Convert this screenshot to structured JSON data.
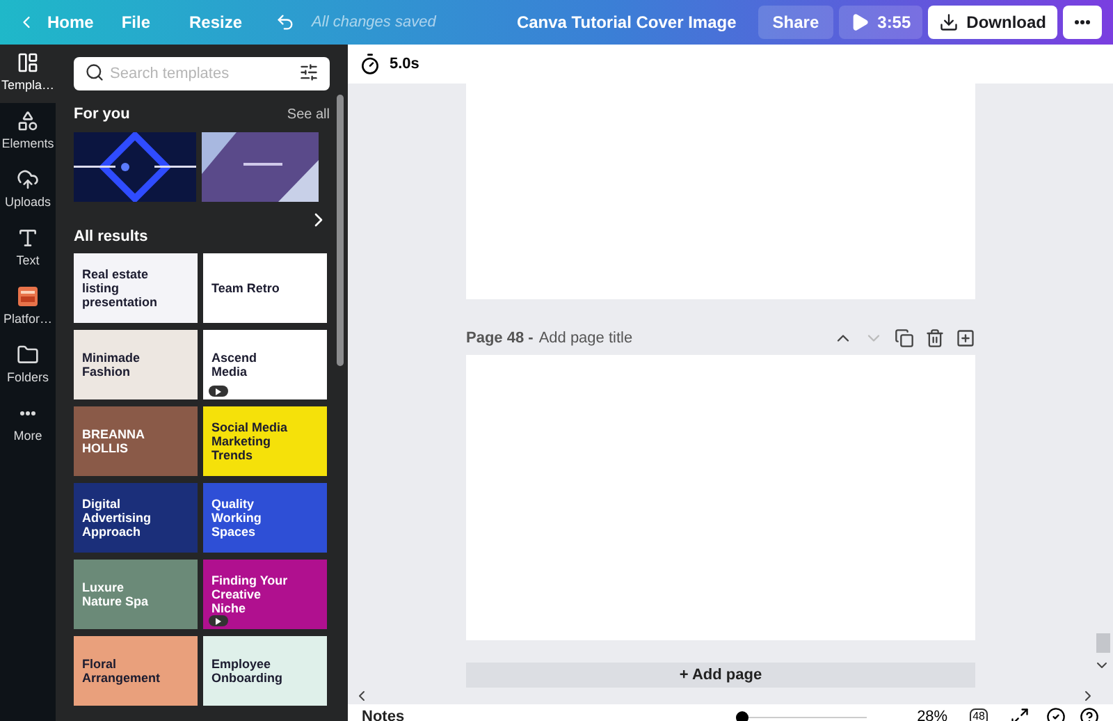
{
  "topbar": {
    "back": "Home",
    "menu": [
      "File",
      "Resize"
    ],
    "status": "All changes saved",
    "title": "Canva Tutorial Cover Image",
    "share": "Share",
    "duration": "3:55",
    "download": "Download"
  },
  "rail": [
    {
      "label": "Templa…",
      "kind": "templates",
      "selected": true
    },
    {
      "label": "Elements",
      "kind": "elements",
      "selected": false
    },
    {
      "label": "Uploads",
      "kind": "uploads",
      "selected": false
    },
    {
      "label": "Text",
      "kind": "text",
      "selected": false
    },
    {
      "label": "Platfor…",
      "kind": "platform",
      "selected": false
    },
    {
      "label": "Folders",
      "kind": "folders",
      "selected": false
    },
    {
      "label": "More",
      "kind": "more",
      "selected": false
    }
  ],
  "panel": {
    "search": {
      "placeholder": "Search templates"
    },
    "for_you": {
      "title": "For you",
      "see_all": "See all"
    },
    "results_title": "All results",
    "templates": [
      {
        "title": "Real estate listing presentation",
        "color": "#f4f4f8",
        "video": false
      },
      {
        "title": "Team Retro",
        "color": "#ffffff",
        "video": false
      },
      {
        "title": "Minimade Fashion",
        "color": "#ede7e1",
        "video": false
      },
      {
        "title": "Ascend Media",
        "color": "#ffffff",
        "video": true
      },
      {
        "title": "BREANNA HOLLIS",
        "color": "#8a5a48",
        "video": false
      },
      {
        "title": "Social Media Marketing Trends",
        "color": "#f5e10a",
        "video": false
      },
      {
        "title": "Digital Advertising Approach",
        "color": "#1b2f7a",
        "video": false
      },
      {
        "title": "Quality Working Spaces",
        "color": "#2e4fd6",
        "video": false
      },
      {
        "title": "Luxure Nature Spa",
        "color": "#6b8a78",
        "video": false
      },
      {
        "title": "Finding Your Creative Niche",
        "color": "#b0108f",
        "video": true
      },
      {
        "title": "Floral Arrangement",
        "color": "#e9a07c",
        "video": false
      },
      {
        "title": "Employee Onboarding",
        "color": "#dff0ea",
        "video": false
      }
    ]
  },
  "editor": {
    "timing": "5.0s",
    "page_label": "Page 48 -",
    "page_title": {
      "placeholder": "Add page title"
    },
    "add_page": "+ Add page"
  },
  "bottombar": {
    "notes": "Notes",
    "zoom": {
      "level": 0.02
    },
    "zoom_reading": "28%",
    "page_count": "48"
  }
}
